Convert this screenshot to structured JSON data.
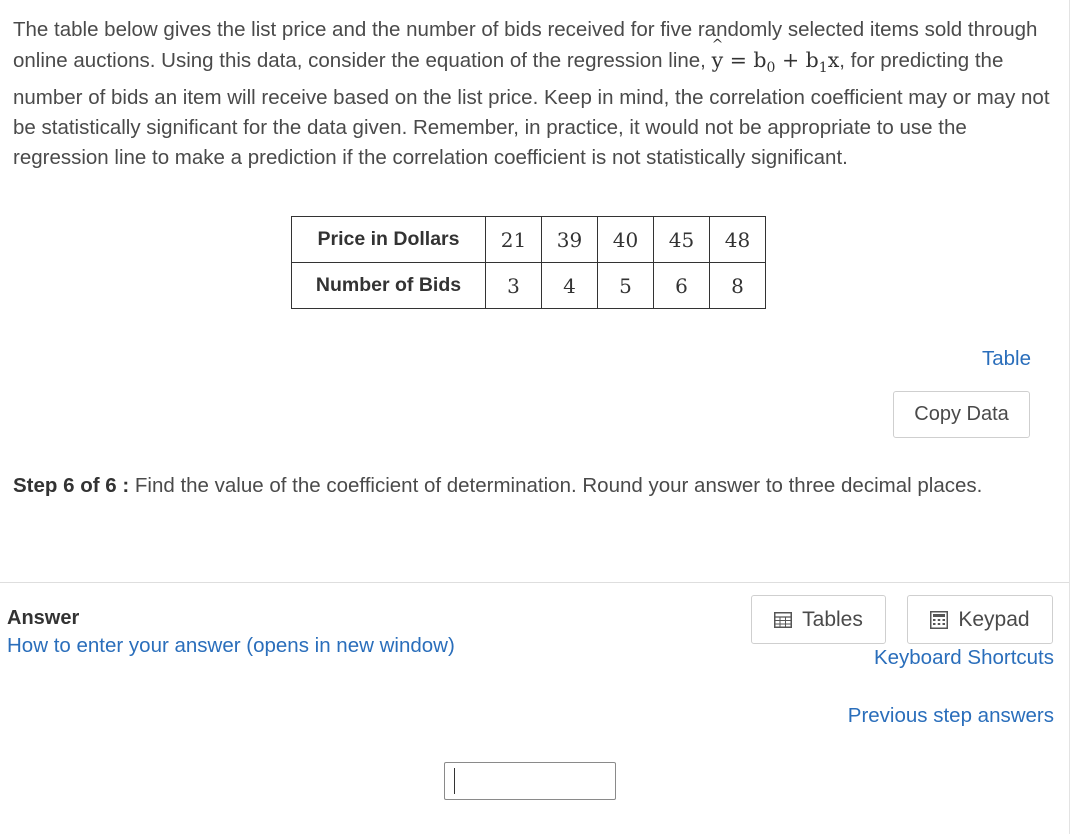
{
  "problem": {
    "text_before": "The table below gives the list price and the number of bids received for five randomly selected items sold through online auctions. Using this data, consider the equation of the regression line, ",
    "equation_lhs": "y",
    "equation_hat": "^",
    "equation_eq": " = ",
    "b0": "b",
    "b0_sub": "0",
    "plus": " + ",
    "b1": "b",
    "b1_sub": "1",
    "x": "x",
    "text_after": ", for predicting the number of bids an item will receive based on the list price. Keep in mind, the correlation coefficient may or may not be statistically significant for the data given. Remember, in practice, it would not be appropriate to use the regression line to make a prediction if the correlation coefficient is not statistically significant."
  },
  "data_table": {
    "row1_header": "Price in Dollars",
    "row1_values": [
      "21",
      "39",
      "40",
      "45",
      "48"
    ],
    "row2_header": "Number of Bids",
    "row2_values": [
      "3",
      "4",
      "5",
      "6",
      "8"
    ]
  },
  "table_link": "Table",
  "copy_data_label": "Copy Data",
  "step": {
    "label": "Step 6 of 6 :",
    "text": " Find the value of the coefficient of determination. Round your answer to three decimal places."
  },
  "answer": {
    "label": "Answer",
    "howto_link": "How to enter your answer (opens in new window)",
    "input_value": ""
  },
  "tools": {
    "tables_label": "Tables",
    "keypad_label": "Keypad",
    "keyboard_shortcuts": "Keyboard Shortcuts",
    "previous_step_answers": "Previous step answers"
  },
  "icons": {
    "tables": "table-grid-icon",
    "keypad": "keypad-icon"
  },
  "colors": {
    "link": "#2a6ebb",
    "text": "#4a4a4a"
  }
}
